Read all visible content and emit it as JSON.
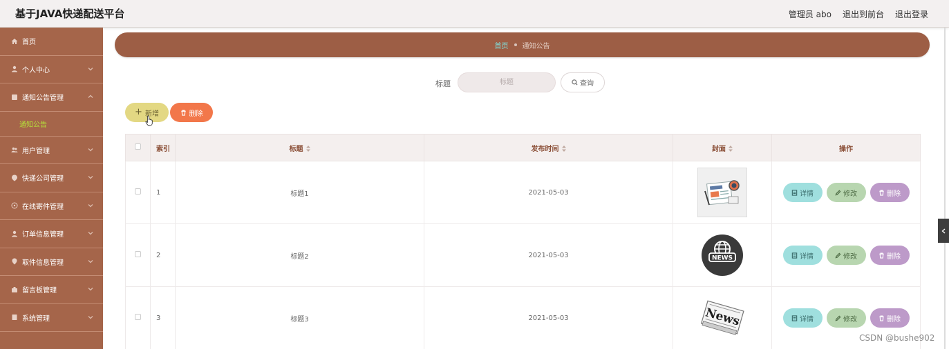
{
  "header": {
    "app_title": "基于JAVA快递配送平台",
    "admin_label": "管理员 abo",
    "to_front": "退出到前台",
    "logout": "退出登录"
  },
  "sidebar": {
    "items": [
      {
        "label": "首页",
        "icon": "home-icon"
      },
      {
        "label": "个人中心",
        "icon": "user-icon"
      },
      {
        "label": "通知公告管理",
        "icon": "notice-icon"
      },
      {
        "label": "用户管理",
        "icon": "users-icon"
      },
      {
        "label": "快递公司管理",
        "icon": "company-icon"
      },
      {
        "label": "在线寄件管理",
        "icon": "send-icon"
      },
      {
        "label": "订单信息管理",
        "icon": "order-icon"
      },
      {
        "label": "取件信息管理",
        "icon": "pickup-icon"
      },
      {
        "label": "留言板管理",
        "icon": "message-icon"
      },
      {
        "label": "系统管理",
        "icon": "system-icon"
      }
    ],
    "sub_item": "通知公告"
  },
  "breadcrumb": {
    "home": "首页",
    "current": "通知公告"
  },
  "search": {
    "label": "标题",
    "placeholder": "标题",
    "button": "查询"
  },
  "toolbar": {
    "add": "新增",
    "delete": "删除"
  },
  "table": {
    "columns": [
      "索引",
      "标题",
      "发布时间",
      "封面",
      "操作"
    ],
    "rows": [
      {
        "index": "1",
        "title": "标题1",
        "date": "2021-05-03",
        "cover": "news-paper-icon"
      },
      {
        "index": "2",
        "title": "标题2",
        "date": "2021-05-03",
        "cover": "news-globe-icon"
      },
      {
        "index": "3",
        "title": "标题3",
        "date": "2021-05-03",
        "cover": "newspaper-icon"
      }
    ],
    "ops": {
      "detail": "详情",
      "edit": "修改",
      "remove": "删除"
    }
  },
  "watermark": "CSDN @bushe902",
  "colors": {
    "sidebar": "#a5654a",
    "breadcrumb_bar": "#9d5e45",
    "add_button": "#e3d883",
    "delete_button": "#f2774a",
    "detail_button": "#9fdfde",
    "edit_button": "#b8d6b0",
    "remove_button": "#bd9ac9"
  }
}
